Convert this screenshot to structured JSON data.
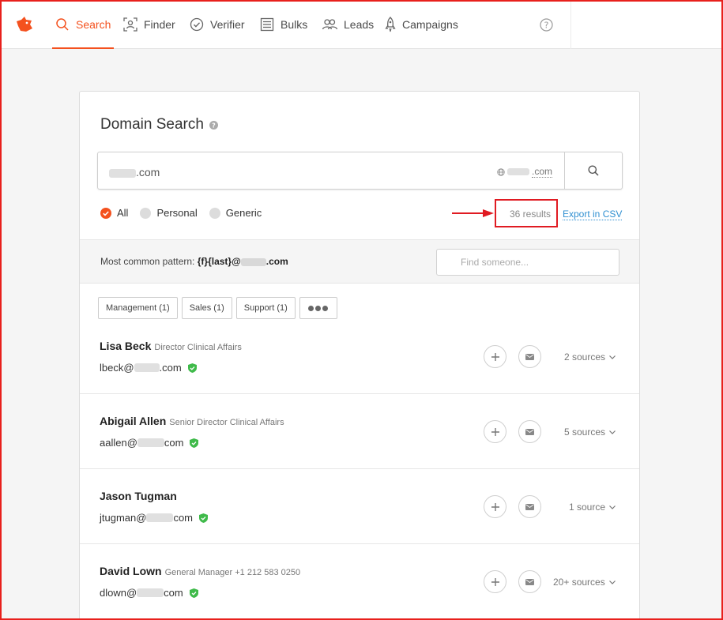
{
  "nav": {
    "items": [
      {
        "label": "Search",
        "icon": "search-icon",
        "active": true
      },
      {
        "label": "Finder",
        "icon": "finder-icon",
        "active": false
      },
      {
        "label": "Verifier",
        "icon": "check-circle-icon",
        "active": false
      },
      {
        "label": "Bulks",
        "icon": "list-icon",
        "active": false
      },
      {
        "label": "Leads",
        "icon": "people-icon",
        "active": false
      },
      {
        "label": "Campaigns",
        "icon": "rocket-icon",
        "active": false
      }
    ]
  },
  "colors": {
    "accent": "#f4511e",
    "link": "#2f8fd1",
    "verified": "#3fba4a",
    "highlight": "#e01b22"
  },
  "card": {
    "title": "Domain Search",
    "search": {
      "value_suffix": ".com",
      "domain_suffix": ".com"
    },
    "filters": [
      {
        "label": "All",
        "checked": true
      },
      {
        "label": "Personal",
        "checked": false
      },
      {
        "label": "Generic",
        "checked": false
      }
    ],
    "results_count": "36 results",
    "export_label": "Export in CSV",
    "pattern": {
      "label": "Most common pattern:",
      "value_prefix": "{f}{last}@",
      "value_suffix": ".com"
    },
    "find_placeholder": "Find someone...",
    "departments": [
      "Management (1)",
      "Sales (1)",
      "Support (1)"
    ]
  },
  "people": [
    {
      "name": "Lisa Beck",
      "title": "Director Clinical Affairs",
      "email_prefix": "lbeck@",
      "email_suffix": ".com",
      "sources": "2 sources"
    },
    {
      "name": "Abigail Allen",
      "title": "Senior Director Clinical Affairs",
      "email_prefix": "aallen@",
      "email_suffix": "com",
      "sources": "5 sources"
    },
    {
      "name": "Jason Tugman",
      "title": "",
      "email_prefix": "jtugman@",
      "email_suffix": "com",
      "sources": "1 source"
    },
    {
      "name": "David Lown",
      "title": "General Manager +1 212 583 0250",
      "email_prefix": "dlown@",
      "email_suffix": "com",
      "sources": "20+ sources"
    }
  ]
}
